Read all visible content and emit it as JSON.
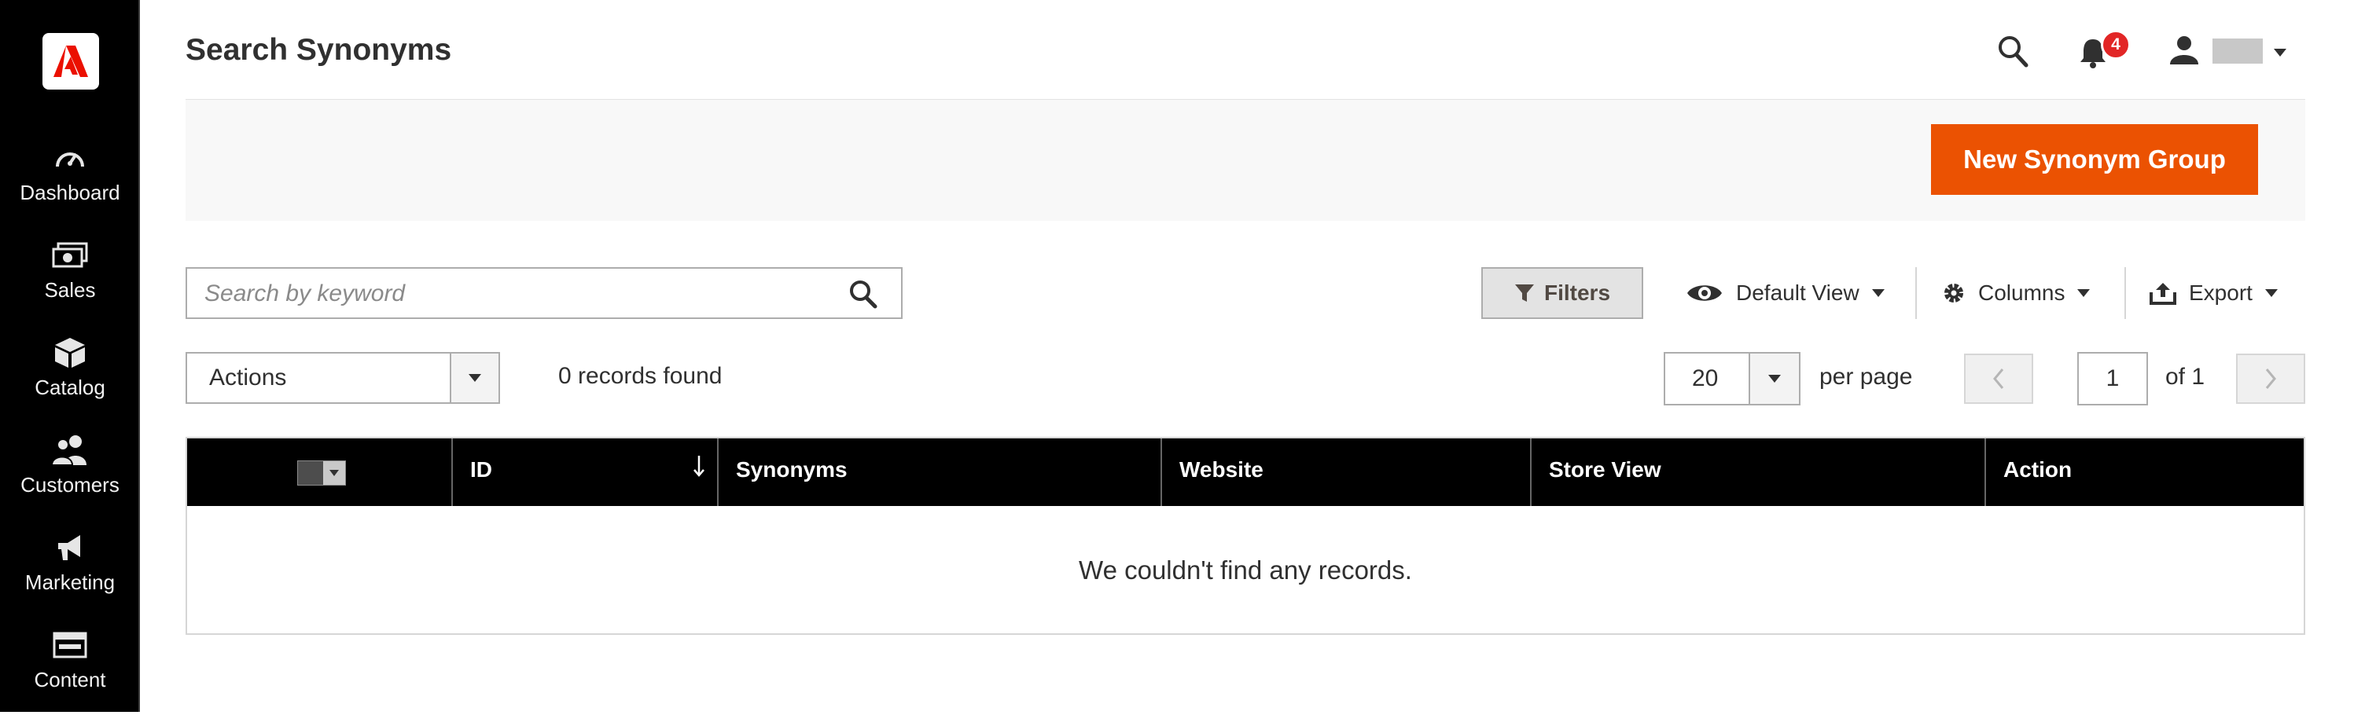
{
  "sidebar": {
    "logo_icon": "adobe-logo-icon",
    "items": [
      {
        "label": "Dashboard",
        "icon": "dashboard-gauge-icon"
      },
      {
        "label": "Sales",
        "icon": "sales-money-icon"
      },
      {
        "label": "Catalog",
        "icon": "catalog-box-icon"
      },
      {
        "label": "Customers",
        "icon": "customers-people-icon"
      },
      {
        "label": "Marketing",
        "icon": "marketing-megaphone-icon"
      },
      {
        "label": "Content",
        "icon": "content-layout-icon"
      }
    ]
  },
  "header": {
    "title": "Search Synonyms",
    "notification_count": "4"
  },
  "action_bar": {
    "primary_button": "New Synonym Group"
  },
  "toolbar": {
    "search_placeholder": "Search by keyword",
    "filters_label": "Filters",
    "view_label": "Default View",
    "columns_label": "Columns",
    "export_label": "Export"
  },
  "mass_actions": {
    "select_label": "Actions",
    "records_found": "0 records found"
  },
  "pagination": {
    "per_page_value": "20",
    "per_page_label": "per page",
    "current_page": "1",
    "total_label": "of 1"
  },
  "grid": {
    "columns": [
      "ID",
      "Synonyms",
      "Website",
      "Store View",
      "Action"
    ],
    "empty_message": "We couldn't find any records."
  },
  "colors": {
    "sidebar_bg": "#000000",
    "accent": "#eb5202",
    "badge": "#e22626",
    "grid_header_bg": "#000000"
  }
}
